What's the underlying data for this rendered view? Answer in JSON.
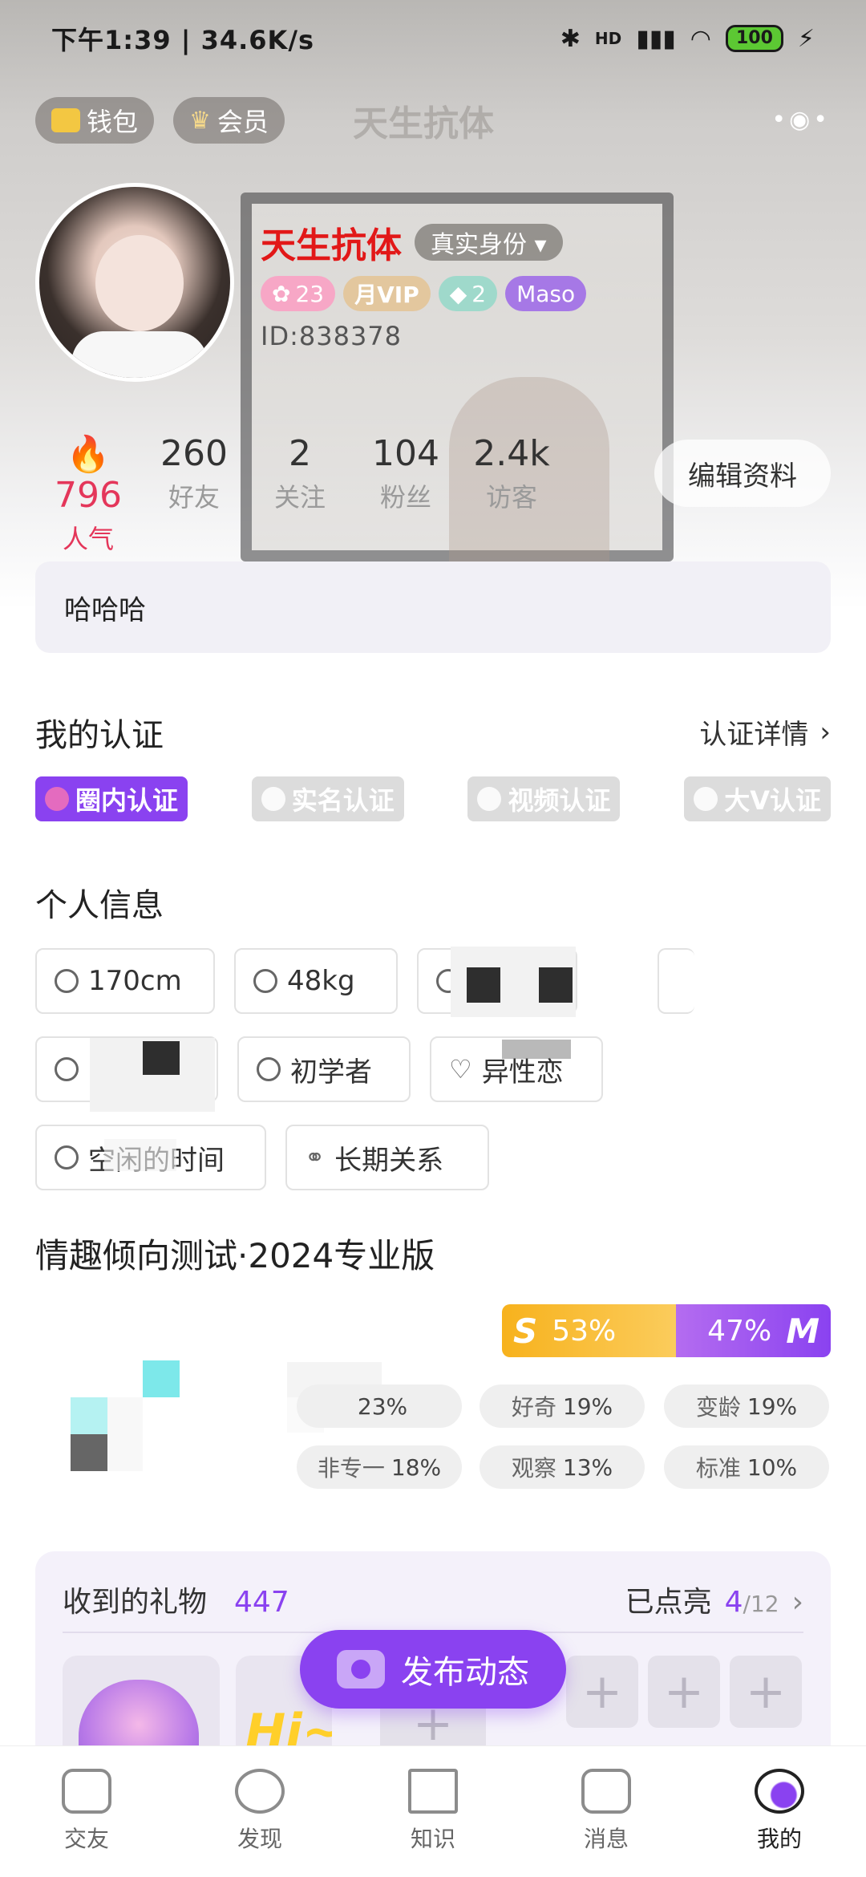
{
  "status_bar": {
    "time": "下午1:39 | 34.6K/s",
    "signal": "HD",
    "battery": "100"
  },
  "top_nav": {
    "wallet_label": "钱包",
    "vip_label": "会员",
    "title": "天生抗体",
    "more_icon": "more-dots-icon"
  },
  "profile": {
    "nickname": "天生抗体",
    "identity_label": "真实身份 ▾",
    "badges": {
      "level": "23",
      "vip": "月VIP",
      "gem": "2",
      "tag": "Maso"
    },
    "user_id": "ID:838378"
  },
  "stats": [
    {
      "num": "796",
      "label": "人气"
    },
    {
      "num": "260",
      "label": "好友"
    },
    {
      "num": "2",
      "label": "关注"
    },
    {
      "num": "104",
      "label": "粉丝"
    },
    {
      "num": "2.4k",
      "label": "访客"
    }
  ],
  "edit_profile_label": "编辑资料",
  "bio": "哈哈哈",
  "certification": {
    "title": "我的认证",
    "detail_label": "认证详情",
    "items": [
      {
        "label": "圈内认证",
        "active": true
      },
      {
        "label": "实名认证",
        "active": false
      },
      {
        "label": "视频认证",
        "active": false
      },
      {
        "label": "大V认证",
        "active": false
      }
    ]
  },
  "personal_info": {
    "title": "个人信息",
    "chips": {
      "height": "170cm",
      "weight": "48kg",
      "experience": "初学者",
      "orientation": "异性恋",
      "time": "空闲的时间",
      "relationship": "长期关系"
    }
  },
  "test": {
    "title": "情趣倾向测试·2024专业版",
    "s_letter": "S",
    "s_pct": "53%",
    "m_letter": "M",
    "m_pct": "47%",
    "traits": [
      {
        "label": "",
        "pct": "23%"
      },
      {
        "label": "好奇",
        "pct": "19%"
      },
      {
        "label": "变龄",
        "pct": "19%"
      },
      {
        "label": "非专一",
        "pct": "18%"
      },
      {
        "label": "观察",
        "pct": "13%"
      },
      {
        "label": "标准",
        "pct": "10%"
      }
    ]
  },
  "gifts": {
    "title": "收到的礼物",
    "count": "447",
    "lit_label": "已点亮",
    "lit_num": "4",
    "lit_total": "/12"
  },
  "publish_label": "发布动态",
  "tabbar": [
    {
      "label": "交友",
      "icon": "mask-icon"
    },
    {
      "label": "发现",
      "icon": "planet-icon"
    },
    {
      "label": "知识",
      "icon": "book-icon"
    },
    {
      "label": "消息",
      "icon": "chat-icon"
    },
    {
      "label": "我的",
      "icon": "profile-icon"
    }
  ],
  "colors": {
    "accent": "#8a42f0",
    "nickname": "#e21818",
    "popularity": "#e4365a"
  }
}
